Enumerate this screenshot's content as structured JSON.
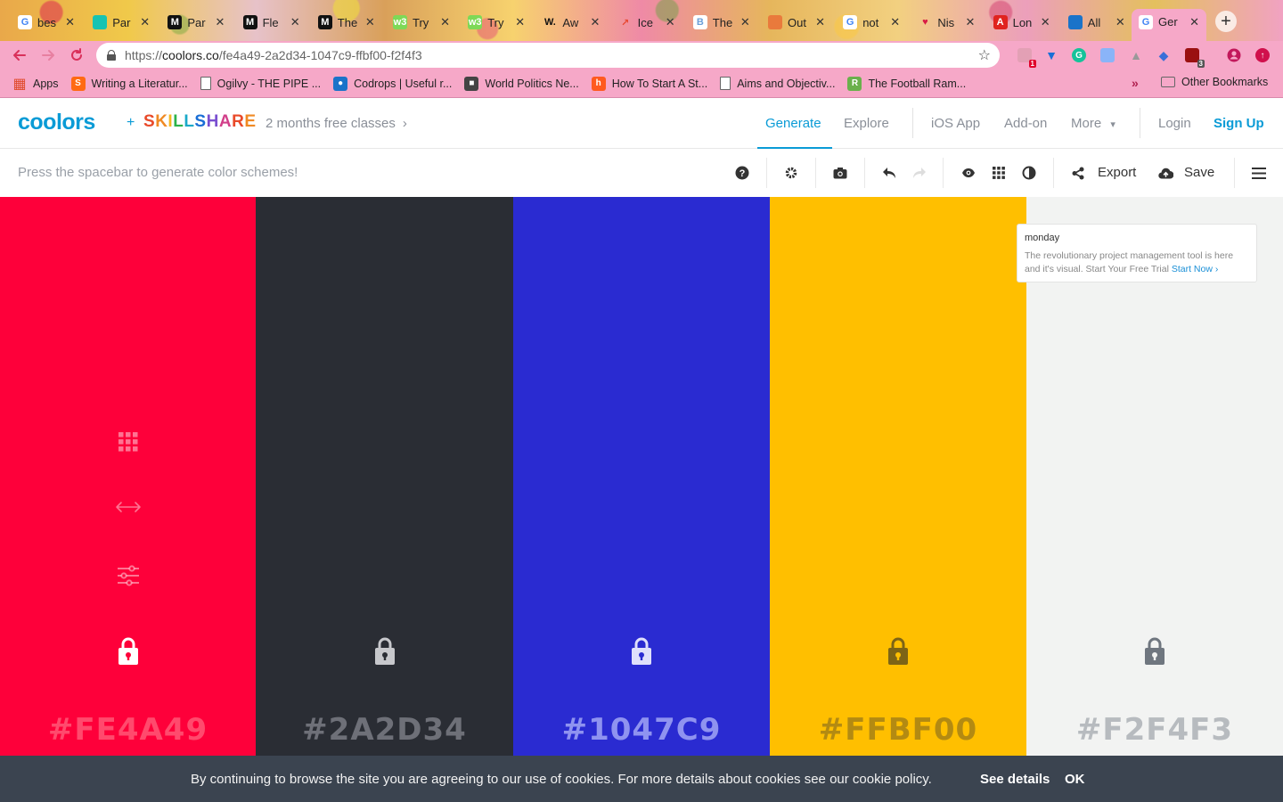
{
  "browser": {
    "tabs": [
      {
        "label": "bes",
        "fav_color": "#ffffff",
        "fav_glyph": "G",
        "fav_text": "#4285f4"
      },
      {
        "label": "Par",
        "fav_color": "#17c3b2",
        "fav_glyph": "",
        "fav_text": "#fff"
      },
      {
        "label": "Par",
        "fav_color": "#111111",
        "fav_glyph": "M",
        "fav_text": "#fff"
      },
      {
        "label": "Fle",
        "fav_color": "#111111",
        "fav_glyph": "M",
        "fav_text": "#fff"
      },
      {
        "label": "The",
        "fav_color": "#111111",
        "fav_glyph": "M",
        "fav_text": "#fff"
      },
      {
        "label": "Try",
        "fav_color": "#7ed957",
        "fav_glyph": "w3",
        "fav_text": "#fff"
      },
      {
        "label": "Try",
        "fav_color": "#7ed957",
        "fav_glyph": "w3",
        "fav_text": "#fff"
      },
      {
        "label": "Aw",
        "fav_color": "transparent",
        "fav_glyph": "W.",
        "fav_text": "#111"
      },
      {
        "label": "Ice",
        "fav_color": "transparent",
        "fav_glyph": "↗",
        "fav_text": "#e8472f"
      },
      {
        "label": "The",
        "fav_color": "#ffffff",
        "fav_glyph": "B",
        "fav_text": "#6b9fd8"
      },
      {
        "label": "Out",
        "fav_color": "#e97a3c",
        "fav_glyph": "",
        "fav_text": "#fff"
      },
      {
        "label": "not",
        "fav_color": "#ffffff",
        "fav_glyph": "G",
        "fav_text": "#4285f4"
      },
      {
        "label": "Nis",
        "fav_color": "transparent",
        "fav_glyph": "♥",
        "fav_text": "#d81b45"
      },
      {
        "label": "Lon",
        "fav_color": "#e0231f",
        "fav_glyph": "A",
        "fav_text": "#fff"
      },
      {
        "label": "All",
        "fav_color": "#1a73c9",
        "fav_glyph": "",
        "fav_text": "#fff"
      },
      {
        "label": "Ger",
        "fav_color": "#ffffff",
        "fav_glyph": "G",
        "fav_text": "#4285f4"
      }
    ],
    "new_tab": "+",
    "url_prefix": "https://",
    "url_domain": "coolors.co",
    "url_path": "/fe4a49-2a2d34-1047c9-ffbf00-f2f4f3",
    "bookmarks": [
      {
        "label": "Apps",
        "icon": "grid"
      },
      {
        "label": "Writing a Literatur...",
        "icon": "S"
      },
      {
        "label": "Ogilvy - THE PIPE ...",
        "icon": "doc"
      },
      {
        "label": "Codrops | Useful r...",
        "icon": "drop"
      },
      {
        "label": "World Politics Ne...",
        "icon": "square"
      },
      {
        "label": "How To Start A St...",
        "icon": "hub"
      },
      {
        "label": "Aims and Objectiv...",
        "icon": "doc"
      },
      {
        "label": "The Football Ram...",
        "icon": "ramble"
      }
    ],
    "bookmarks_more": "»",
    "other_bookmarks": "Other Bookmarks"
  },
  "header": {
    "logo": "coolors",
    "plus": "+",
    "partner": "SKILLSHARE",
    "promo": "2 months free classes",
    "nav": [
      "Generate",
      "Explore",
      "iOS App",
      "Add-on",
      "More",
      "Login",
      "Sign Up"
    ]
  },
  "subbar": {
    "hint": "Press the spacebar to generate color schemes!",
    "export_label": "Export",
    "save_label": "Save"
  },
  "palette": {
    "colors": [
      {
        "hex": "#FE4A49",
        "bg": "#fe003a",
        "text": "#ff4a6d",
        "lock": "#ffffff"
      },
      {
        "hex": "#2A2D34",
        "bg": "#2a2d34",
        "text": "#6e7078",
        "lock": "#c7c8cc"
      },
      {
        "hex": "#1047C9",
        "bg": "#2a2bd1",
        "text": "#8f93f0",
        "lock": "#dfe0fb"
      },
      {
        "hex": "#FFBF00",
        "bg": "#ffbf00",
        "text": "#b38a12",
        "lock": "#7d6416"
      },
      {
        "hex": "#F2F4F3",
        "bg": "#f2f3f2",
        "text": "#b7bbbf",
        "lock": "#6f767f"
      }
    ]
  },
  "ad": {
    "title": "monday",
    "body": "The revolutionary project management tool is here and it's visual. Start Your Free Trial",
    "cta": "Start Now"
  },
  "cookie": {
    "text": "By continuing to browse the site you are agreeing to our use of cookies. For more details about cookies see our cookie policy.",
    "details": "See details",
    "ok": "OK"
  }
}
